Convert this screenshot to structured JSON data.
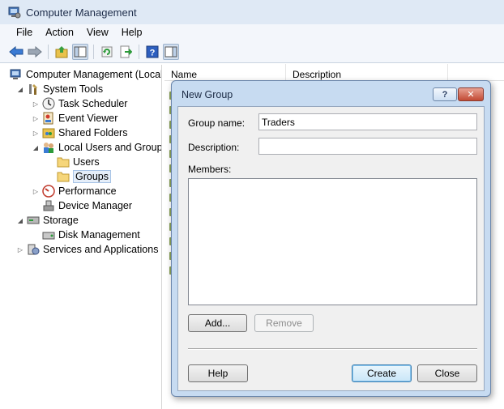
{
  "window": {
    "title": "Computer Management"
  },
  "menu": [
    "File",
    "Action",
    "View",
    "Help"
  ],
  "toolbar": {
    "buttons": [
      "back-arrow-icon",
      "forward-arrow-icon",
      "up-folder-icon",
      "show-hide-tree-icon",
      "refresh-icon",
      "export-list-icon",
      "help-icon",
      "show-hide-action-pane-icon"
    ]
  },
  "tree": {
    "items": [
      {
        "label": "Computer Management (Local",
        "icon": "computer-management-icon",
        "expander": "",
        "level": 0
      },
      {
        "label": "System Tools",
        "icon": "system-tools-icon",
        "expander": "expanded",
        "level": 1
      },
      {
        "label": "Task Scheduler",
        "icon": "clock-icon",
        "expander": "collapsed",
        "level": 2
      },
      {
        "label": "Event Viewer",
        "icon": "event-viewer-icon",
        "expander": "collapsed",
        "level": 2
      },
      {
        "label": "Shared Folders",
        "icon": "shared-folders-icon",
        "expander": "collapsed",
        "level": 2
      },
      {
        "label": "Local Users and Groups",
        "icon": "users-groups-icon",
        "expander": "expanded",
        "level": 2
      },
      {
        "label": "Users",
        "icon": "folder-icon",
        "expander": "",
        "level": 3
      },
      {
        "label": "Groups",
        "icon": "folder-icon",
        "expander": "",
        "level": 3,
        "selected": true
      },
      {
        "label": "Performance",
        "icon": "performance-icon",
        "expander": "collapsed",
        "level": 2
      },
      {
        "label": "Device Manager",
        "icon": "device-manager-icon",
        "expander": "",
        "level": 2
      },
      {
        "label": "Storage",
        "icon": "storage-icon",
        "expander": "expanded",
        "level": 1
      },
      {
        "label": "Disk Management",
        "icon": "disk-management-icon",
        "expander": "",
        "level": 2
      },
      {
        "label": "Services and Applications",
        "icon": "services-icon",
        "expander": "collapsed",
        "level": 1
      }
    ]
  },
  "list": {
    "columns": [
      "Name",
      "Description"
    ]
  },
  "dialog": {
    "title": "New Group",
    "help_symbol": "?",
    "close_symbol": "✕",
    "group_name_label": "Group name:",
    "group_name_value": "Traders",
    "description_label": "Description:",
    "description_value": "",
    "members_label": "Members:",
    "add_button": "Add...",
    "remove_button": "Remove",
    "help_button": "Help",
    "create_button": "Create",
    "close_button": "Close"
  },
  "colors": {
    "titlebar": "#dfe9f5",
    "dialog_frame": "#c7dbf1",
    "close_button": "#c24a34",
    "selection": "#e5eef9"
  }
}
